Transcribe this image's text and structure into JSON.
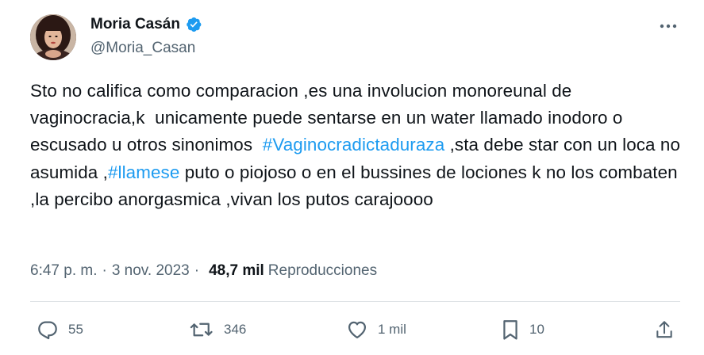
{
  "author": {
    "display_name": "Moria Casán",
    "handle": "@Moria_Casan",
    "verified": true
  },
  "tweet": {
    "segments": [
      {
        "type": "text",
        "value": "Sto no califica como comparacion ,es una involucion monoreunal de vaginocracia,k  unicamente puede sentarse en un water llamado inodoro o escusado u otros sinonimos  "
      },
      {
        "type": "hashtag",
        "value": "#Vaginocradictaduraza"
      },
      {
        "type": "text",
        "value": " ,sta debe star con un loca no asumida ,"
      },
      {
        "type": "hashtag",
        "value": "#llamese"
      },
      {
        "type": "text",
        "value": " puto o piojoso o en el bussines de lociones k no los combaten ,la percibo anorgasmica ,vivan los putos carajoooo"
      }
    ]
  },
  "meta": {
    "time": "6:47 p. m.",
    "separator": "·",
    "date": "3 nov. 2023",
    "views_count": "48,7 mil",
    "views_label": "Reproducciones"
  },
  "actions": {
    "replies": "55",
    "retweets": "346",
    "likes": "1 mil",
    "bookmarks": "10"
  },
  "colors": {
    "accent": "#1d9bf0",
    "secondary_text": "#536471",
    "primary_text": "#0f1419"
  },
  "icons": [
    "verified-badge-icon",
    "more-icon",
    "reply-icon",
    "retweet-icon",
    "like-icon",
    "bookmark-icon",
    "share-icon"
  ]
}
